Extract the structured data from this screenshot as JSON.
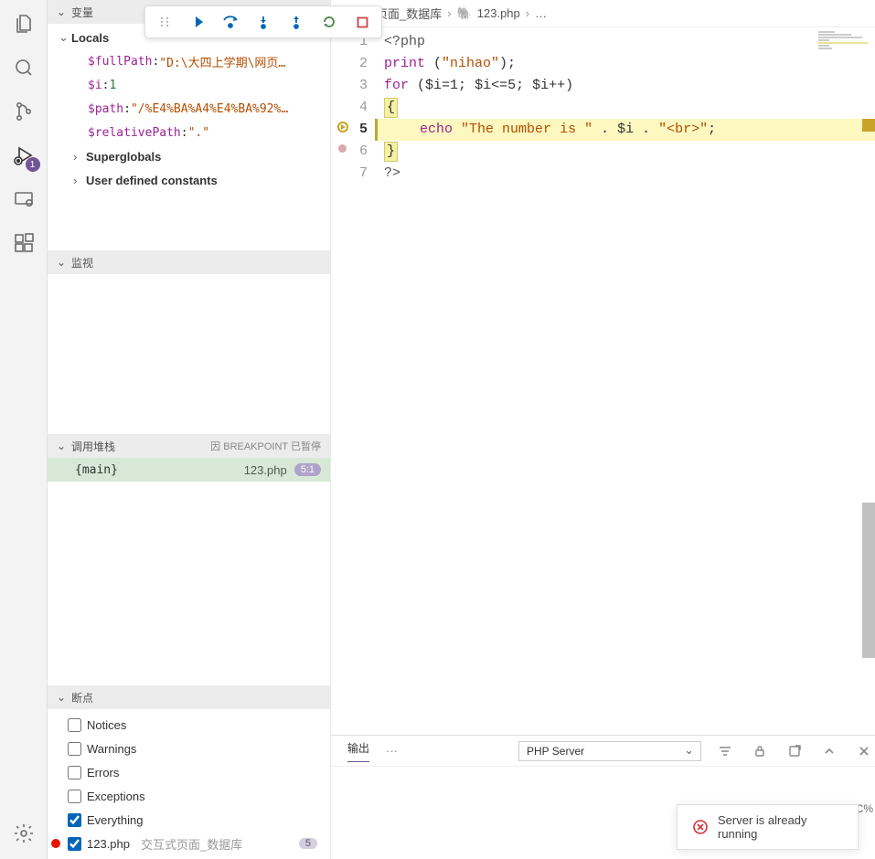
{
  "activity": {
    "debug_badge": "1"
  },
  "debug_toolbar": {
    "tooltip": ""
  },
  "sidebar": {
    "variables": {
      "header": "变量",
      "locals_label": "Locals",
      "vars": [
        {
          "name": "$fullPath",
          "sep": ": ",
          "value": "\"D:\\大四上学期\\网页…",
          "type": "str"
        },
        {
          "name": "$i",
          "sep": ": ",
          "value": "1",
          "type": "num"
        },
        {
          "name": "$path",
          "sep": ": ",
          "value": "\"/%E4%BA%A4%E4%BA%92%…",
          "type": "str"
        },
        {
          "name": "$relativePath",
          "sep": ": ",
          "value": "\".\"",
          "type": "str"
        }
      ],
      "superglobals_label": "Superglobals",
      "constants_label": "User defined constants"
    },
    "watch": {
      "header": "监视"
    },
    "callstack": {
      "header": "调用堆栈",
      "meta": "因 BREAKPOINT 已暂停",
      "frame": {
        "name": "{main}",
        "file": "123.php",
        "pos": "5:1"
      }
    },
    "breakpoints": {
      "header": "断点",
      "items": [
        {
          "checked": false,
          "label": "Notices"
        },
        {
          "checked": false,
          "label": "Warnings"
        },
        {
          "checked": false,
          "label": "Errors"
        },
        {
          "checked": false,
          "label": "Exceptions"
        },
        {
          "checked": true,
          "label": "Everything"
        }
      ],
      "file_bp": {
        "checked": true,
        "label": "123.php",
        "folder": "交互式页面_数据库",
        "count": "5"
      }
    }
  },
  "breadcrumb": {
    "part1": "式页面_数据库",
    "part2": "123.php",
    "part3": "…"
  },
  "code": {
    "lines": [
      "1",
      "2",
      "3",
      "4",
      "5",
      "6",
      "7"
    ],
    "l1_tag": "<?php",
    "l2_fn": "print",
    "l2_rest": " (",
    "l2_str": "\"nihao\"",
    "l2_end": ");",
    "l3_kw": "for",
    "l3_rest": " (",
    "l3_v1": "$i=1",
    "l3_s1": "; ",
    "l3_v2": "$i<=5",
    "l3_s2": "; ",
    "l3_v3": "$i++",
    "l3_end": ")",
    "l4_brace": "{",
    "l5_kw": "echo",
    "l5_sp": " ",
    "l5_str1": "\"The number is \"",
    "l5_op1": " . ",
    "l5_var": "$i",
    "l5_op2": " . ",
    "l5_str2": "\"<br>\"",
    "l5_end": ";",
    "l6_brace": "}",
    "l7_tag": "?>"
  },
  "panel": {
    "tab_output": "输出",
    "dropdown": "PHP Server"
  },
  "toast": {
    "message": "Server is already running",
    "side": "C%"
  }
}
